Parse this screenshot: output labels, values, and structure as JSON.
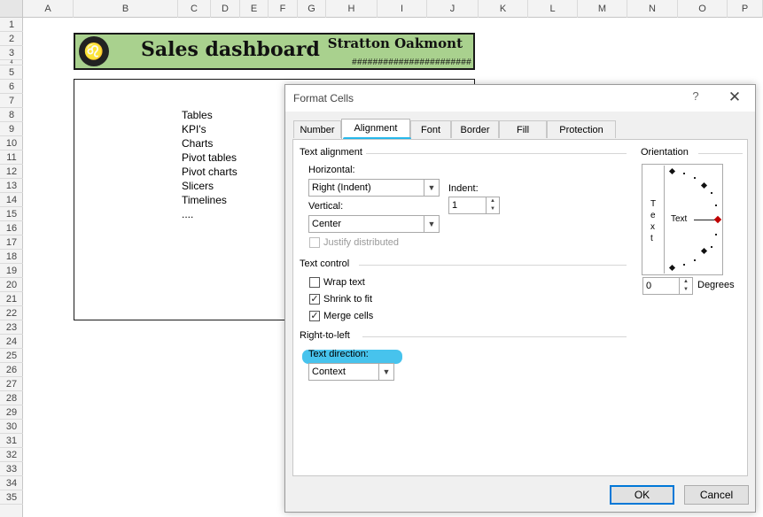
{
  "spreadsheet": {
    "columns": [
      "A",
      "B",
      "C",
      "D",
      "E",
      "F",
      "G",
      "H",
      "I",
      "J",
      "K",
      "L",
      "M",
      "N",
      "O",
      "P"
    ],
    "rows": [
      "1",
      "2",
      "3",
      "4",
      "5",
      "6",
      "7",
      "8",
      "9",
      "10",
      "11",
      "12",
      "13",
      "14",
      "15",
      "16",
      "17",
      "18",
      "19",
      "20",
      "21",
      "22",
      "23",
      "24",
      "25",
      "26",
      "27",
      "28",
      "29",
      "30",
      "31",
      "32",
      "33",
      "34",
      "35"
    ],
    "banner": {
      "title": "Sales dashboard",
      "company": "Stratton Oakmont",
      "hash_value": "#######################"
    },
    "features": [
      "Tables",
      "KPI's",
      "Charts",
      "Pivot tables",
      "Pivot charts",
      "Slicers",
      "Timelines",
      "...."
    ]
  },
  "dialog": {
    "title": "Format Cells",
    "help": "?",
    "close": "✕",
    "tabs": [
      "Number",
      "Alignment",
      "Font",
      "Border",
      "Fill",
      "Protection"
    ],
    "active_tab": "Alignment",
    "text_alignment": {
      "section": "Text alignment",
      "horizontal_label": "Horizontal:",
      "horizontal_value": "Right (Indent)",
      "vertical_label": "Vertical:",
      "vertical_value": "Center",
      "indent_label": "Indent:",
      "indent_value": "1",
      "justify_distributed": "Justify distributed"
    },
    "text_control": {
      "section": "Text control",
      "wrap_text": "Wrap text",
      "shrink_to_fit": "Shrink to fit",
      "merge_cells": "Merge cells",
      "wrap_checked": false,
      "shrink_checked": true,
      "merge_checked": true
    },
    "rtl": {
      "section": "Right-to-left",
      "direction_label": "Text direction:",
      "direction_value": "Context"
    },
    "orientation": {
      "section": "Orientation",
      "vertical_text": [
        "T",
        "e",
        "x",
        "t"
      ],
      "text_label": "Text",
      "degrees_value": "0",
      "degrees_label": "Degrees"
    },
    "buttons": {
      "ok": "OK",
      "cancel": "Cancel"
    },
    "accent_highlight": "#27b8ea"
  }
}
